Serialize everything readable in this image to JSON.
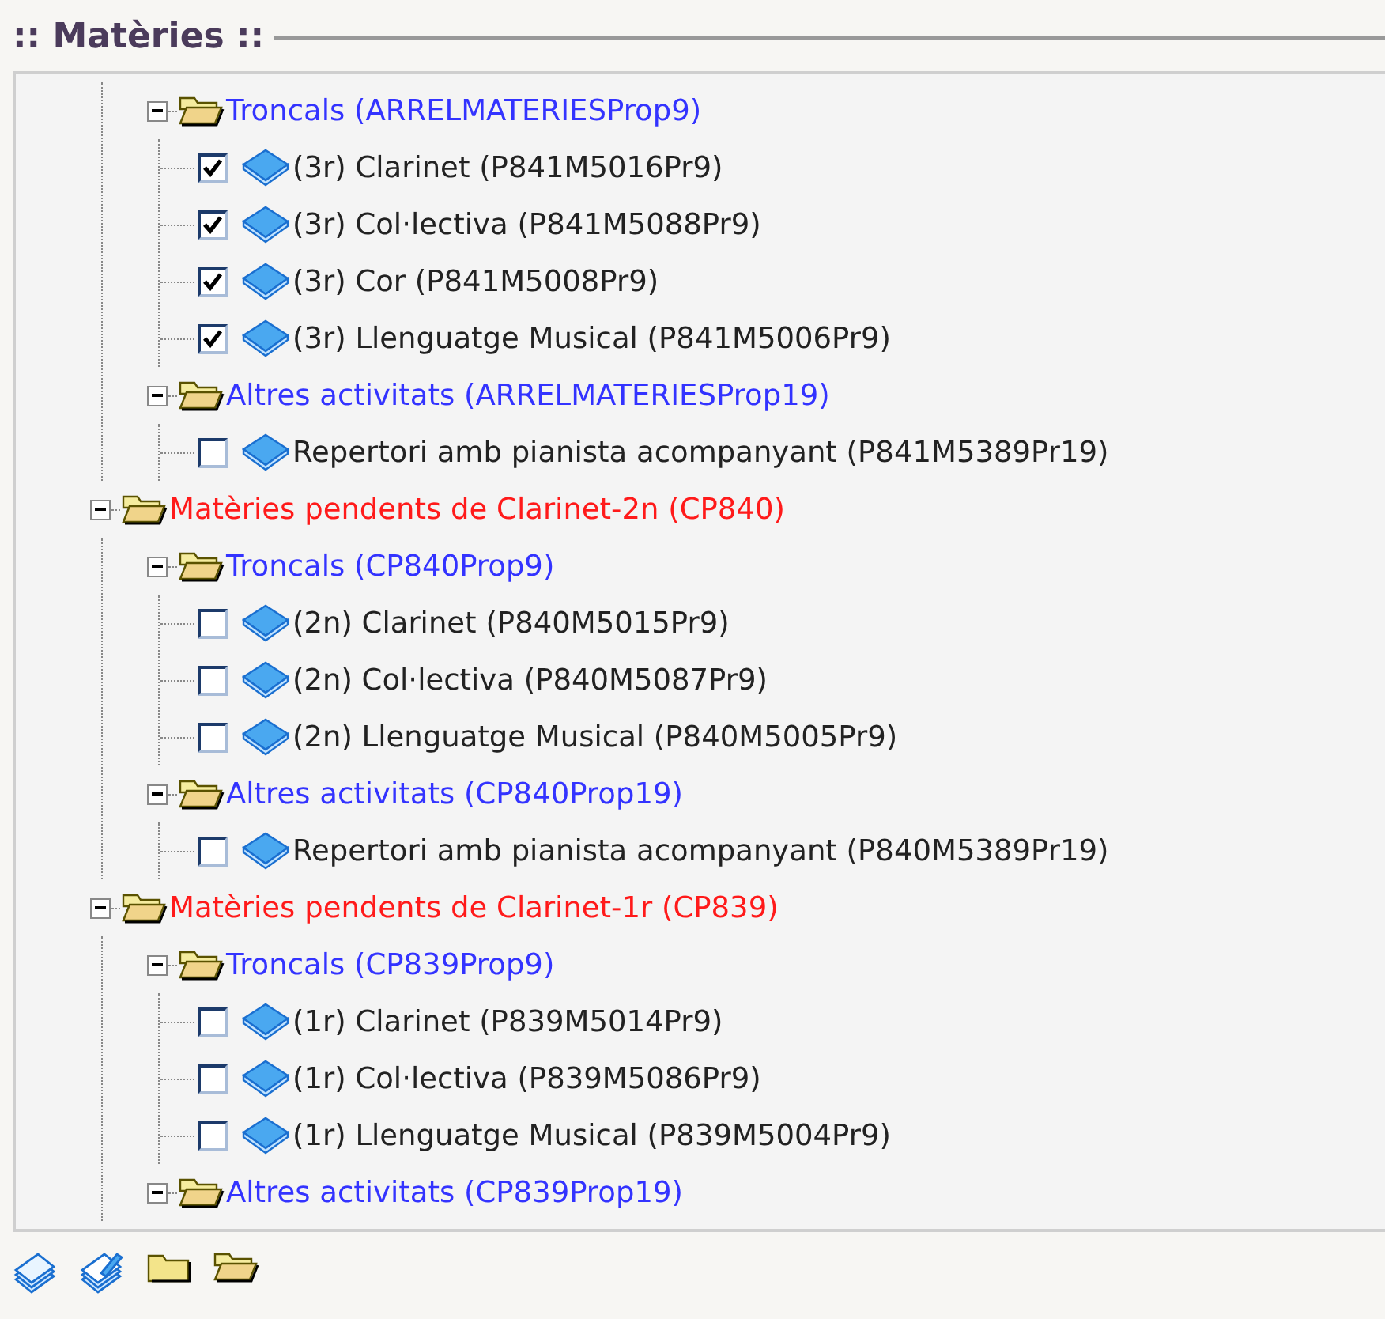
{
  "panel": {
    "title": ":: Matèries ::"
  },
  "tree": [
    {
      "kind": "group",
      "children": [
        {
          "kind": "group",
          "label": "Troncals (ARRELMATERIESProp9)",
          "color": "#3333ff",
          "expanded": true,
          "children": [
            {
              "kind": "leaf",
              "label": "(3r) Clarinet (P841M5016Pr9)",
              "checked": true
            },
            {
              "kind": "leaf",
              "label": "(3r) Col·lectiva (P841M5088Pr9)",
              "checked": true
            },
            {
              "kind": "leaf",
              "label": "(3r) Cor (P841M5008Pr9)",
              "checked": true
            },
            {
              "kind": "leaf",
              "label": "(3r) Llenguatge Musical (P841M5006Pr9)",
              "checked": true
            }
          ]
        },
        {
          "kind": "group",
          "label": "Altres activitats (ARRELMATERIESProp19)",
          "color": "#3333ff",
          "expanded": true,
          "children": [
            {
              "kind": "leaf",
              "label": "Repertori amb pianista acompanyant (P841M5389Pr19)",
              "checked": false
            }
          ]
        }
      ]
    },
    {
      "kind": "group",
      "label": "Matèries pendents de Clarinet-2n (CP840)",
      "color": "#ff1a1a",
      "expanded": true,
      "children": [
        {
          "kind": "group",
          "label": "Troncals (CP840Prop9)",
          "color": "#3333ff",
          "expanded": true,
          "children": [
            {
              "kind": "leaf",
              "label": "(2n) Clarinet (P840M5015Pr9)",
              "checked": false
            },
            {
              "kind": "leaf",
              "label": "(2n) Col·lectiva (P840M5087Pr9)",
              "checked": false
            },
            {
              "kind": "leaf",
              "label": "(2n) Llenguatge Musical (P840M5005Pr9)",
              "checked": false
            }
          ]
        },
        {
          "kind": "group",
          "label": "Altres activitats (CP840Prop19)",
          "color": "#3333ff",
          "expanded": true,
          "children": [
            {
              "kind": "leaf",
              "label": "Repertori amb pianista acompanyant (P840M5389Pr19)",
              "checked": false
            }
          ]
        }
      ]
    },
    {
      "kind": "group",
      "label": "Matèries pendents de Clarinet-1r (CP839)",
      "color": "#ff1a1a",
      "expanded": true,
      "children": [
        {
          "kind": "group",
          "label": "Troncals (CP839Prop9)",
          "color": "#3333ff",
          "expanded": true,
          "children": [
            {
              "kind": "leaf",
              "label": "(1r) Clarinet (P839M5014Pr9)",
              "checked": false
            },
            {
              "kind": "leaf",
              "label": "(1r) Col·lectiva (P839M5086Pr9)",
              "checked": false
            },
            {
              "kind": "leaf",
              "label": "(1r) Llenguatge Musical (P839M5004Pr9)",
              "checked": false
            }
          ]
        },
        {
          "kind": "group",
          "label": "Altres activitats (CP839Prop19)",
          "color": "#3333ff",
          "expanded": true
        }
      ]
    }
  ],
  "toolbar": [
    {
      "kind": "check-all"
    },
    {
      "kind": "uncheck-all"
    },
    {
      "kind": "collapse"
    },
    {
      "kind": "expand"
    }
  ]
}
